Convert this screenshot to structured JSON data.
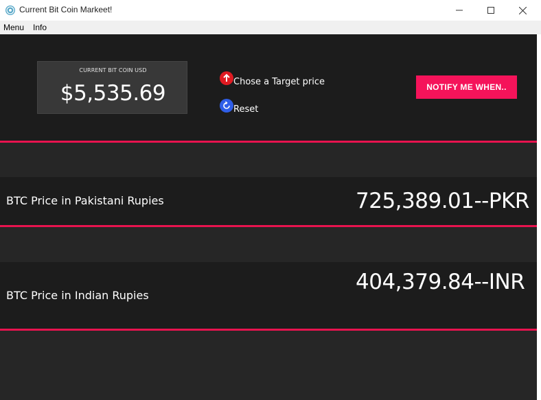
{
  "window": {
    "title": "Current Bit Coin Markeet!",
    "icons": {
      "app": "app-logo-icon",
      "minimize": "minimize-icon",
      "maximize": "maximize-icon",
      "close": "close-icon"
    }
  },
  "menubar": {
    "items": [
      {
        "label": "Menu"
      },
      {
        "label": "Info"
      }
    ]
  },
  "usd_panel": {
    "label": "CURRENT BIT COIN USD",
    "value": "$5,535.69"
  },
  "target": {
    "label": "Chose a Target price",
    "icon": "arrow-up-icon",
    "icon_color": "#e01b22"
  },
  "reset": {
    "label": "Reset",
    "icon": "refresh-icon",
    "icon_color": "#2f5ee8"
  },
  "notify_button": {
    "label": "NOTIFY ME WHEN..",
    "color": "#f5135a"
  },
  "rates": [
    {
      "label": "BTC Price in Pakistani Rupies",
      "value": "725,389.01--PKR"
    },
    {
      "label": "BTC Price in Indian Rupies",
      "value": "404,379.84--INR"
    }
  ],
  "theme": {
    "background": "#262626",
    "band": "#1c1c1c",
    "accent": "#e8134f"
  }
}
